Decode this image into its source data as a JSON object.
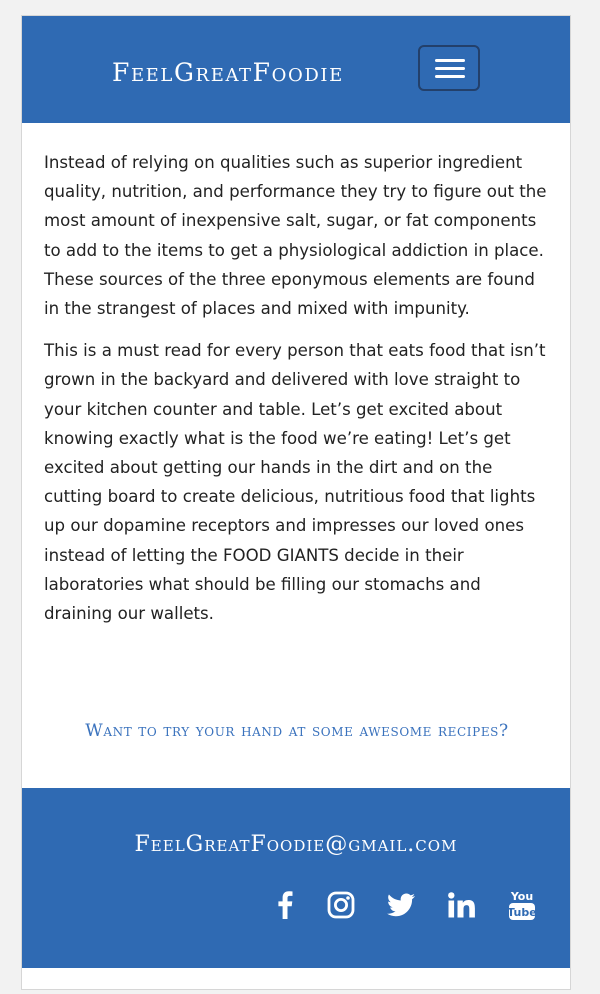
{
  "header": {
    "brand": "FeelGreatFoodie",
    "menu_icon": "hamburger-menu-icon"
  },
  "article": {
    "paragraphs": [
      "Instead of relying on qualities such as superior ingredient quality, nutrition, and performance they try to figure out the most amount of inexpensive salt, sugar, or fat components to add to the items to get a physiological addiction in place. These sources of the three eponymous elements are found in the strangest of places and mixed with impunity.",
      "This is a must read for every person that eats food that isn’t grown in the backyard and delivered with love straight to your kitchen counter and table. Let’s get excited about knowing exactly what is the food we’re eating! Let’s get excited about getting our hands in the dirt and on the cutting board to create delicious, nutritious food that lights up our dopamine receptors and impresses our loved ones instead of letting the FOOD GIANTS decide in their laboratories what should be filling our stomachs and draining our wallets."
    ]
  },
  "cta": {
    "link_text": "Want to try your hand at some awesome recipes?"
  },
  "footer": {
    "email": "FeelGreatFoodie@gmail.com",
    "social_icons": [
      "facebook-icon",
      "instagram-icon",
      "twitter-icon",
      "linkedin-icon",
      "youtube-icon"
    ],
    "youtube_text_top": "You",
    "youtube_text_bottom": "Tube"
  },
  "colors": {
    "brand_blue": "#2f6ab3",
    "link_blue": "#3a72bd",
    "body_text": "#222222"
  }
}
